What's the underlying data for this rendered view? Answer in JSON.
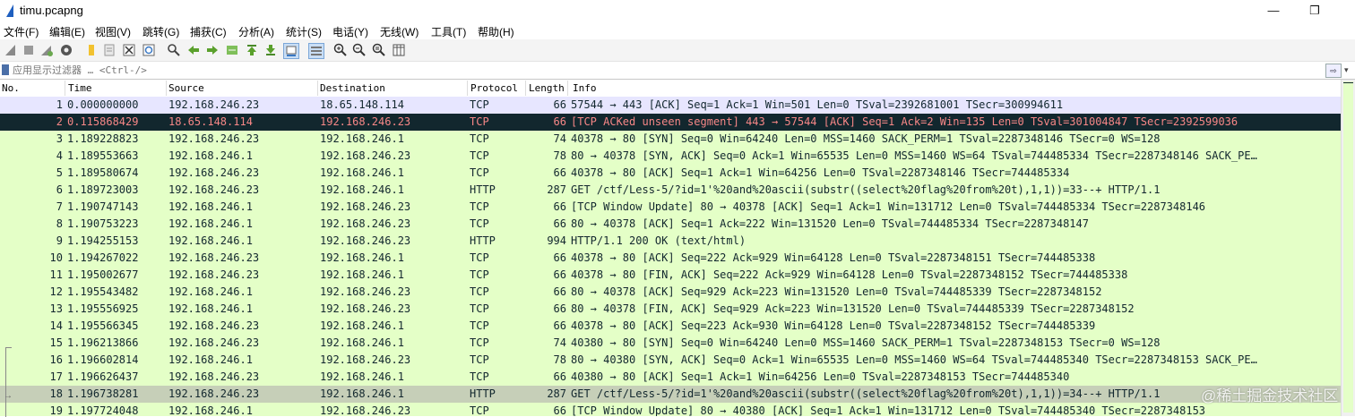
{
  "window": {
    "title": "timu.pcapng"
  },
  "menu": [
    "文件(F)",
    "编辑(E)",
    "视图(V)",
    "跳转(G)",
    "捕获(C)",
    "分析(A)",
    "统计(S)",
    "电话(Y)",
    "无线(W)",
    "工具(T)",
    "帮助(H)"
  ],
  "toolbar": {
    "icons": [
      "start-capture-icon",
      "stop-capture-icon",
      "restart-capture-icon",
      "capture-options-icon",
      "open-file-icon",
      "save-file-icon",
      "close-file-icon",
      "reload-file-icon",
      "find-packet-icon",
      "go-back-icon",
      "go-forward-icon",
      "go-to-packet-icon",
      "go-first-icon",
      "go-last-icon",
      "autoscroll-icon",
      "colorize-icon",
      "zoom-in-icon",
      "zoom-out-icon",
      "normal-size-icon",
      "resize-columns-icon"
    ]
  },
  "filter": {
    "placeholder": "应用显示过滤器 … <Ctrl-/>",
    "value": ""
  },
  "columns": [
    "No.",
    "Time",
    "Source",
    "Destination",
    "Protocol",
    "Length",
    "Info"
  ],
  "packets": [
    {
      "no": "1",
      "time": "0.000000000",
      "src": "192.168.246.23",
      "dst": "18.65.148.114",
      "proto": "TCP",
      "len": "66",
      "info": "57544 → 443 [ACK] Seq=1 Ack=1 Win=501 Len=0 TSval=2392681001 TSecr=300994611",
      "kind": "tcp"
    },
    {
      "no": "2",
      "time": "0.115868429",
      "src": "18.65.148.114",
      "dst": "192.168.246.23",
      "proto": "TCP",
      "len": "66",
      "info": "[TCP ACKed unseen segment] 443 → 57544 [ACK] Seq=1 Ack=2 Win=135 Len=0 TSval=301004847 TSecr=2392599036",
      "kind": "bad"
    },
    {
      "no": "3",
      "time": "1.189228823",
      "src": "192.168.246.23",
      "dst": "192.168.246.1",
      "proto": "TCP",
      "len": "74",
      "info": "40378 → 80 [SYN] Seq=0 Win=64240 Len=0 MSS=1460 SACK_PERM=1 TSval=2287348146 TSecr=0 WS=128",
      "kind": "green"
    },
    {
      "no": "4",
      "time": "1.189553663",
      "src": "192.168.246.1",
      "dst": "192.168.246.23",
      "proto": "TCP",
      "len": "78",
      "info": "80 → 40378 [SYN, ACK] Seq=0 Ack=1 Win=65535 Len=0 MSS=1460 WS=64 TSval=744485334 TSecr=2287348146 SACK_PE…",
      "kind": "green"
    },
    {
      "no": "5",
      "time": "1.189580674",
      "src": "192.168.246.23",
      "dst": "192.168.246.1",
      "proto": "TCP",
      "len": "66",
      "info": "40378 → 80 [ACK] Seq=1 Ack=1 Win=64256 Len=0 TSval=2287348146 TSecr=744485334",
      "kind": "green"
    },
    {
      "no": "6",
      "time": "1.189723003",
      "src": "192.168.246.23",
      "dst": "192.168.246.1",
      "proto": "HTTP",
      "len": "287",
      "info": "GET /ctf/Less-5/?id=1'%20and%20ascii(substr((select%20flag%20from%20t),1,1))=33--+ HTTP/1.1",
      "kind": "green"
    },
    {
      "no": "7",
      "time": "1.190747143",
      "src": "192.168.246.1",
      "dst": "192.168.246.23",
      "proto": "TCP",
      "len": "66",
      "info": "[TCP Window Update] 80 → 40378 [ACK] Seq=1 Ack=1 Win=131712 Len=0 TSval=744485334 TSecr=2287348146",
      "kind": "green"
    },
    {
      "no": "8",
      "time": "1.190753223",
      "src": "192.168.246.1",
      "dst": "192.168.246.23",
      "proto": "TCP",
      "len": "66",
      "info": "80 → 40378 [ACK] Seq=1 Ack=222 Win=131520 Len=0 TSval=744485334 TSecr=2287348147",
      "kind": "green"
    },
    {
      "no": "9",
      "time": "1.194255153",
      "src": "192.168.246.1",
      "dst": "192.168.246.23",
      "proto": "HTTP",
      "len": "994",
      "info": "HTTP/1.1 200 OK  (text/html)",
      "kind": "green"
    },
    {
      "no": "10",
      "time": "1.194267022",
      "src": "192.168.246.23",
      "dst": "192.168.246.1",
      "proto": "TCP",
      "len": "66",
      "info": "40378 → 80 [ACK] Seq=222 Ack=929 Win=64128 Len=0 TSval=2287348151 TSecr=744485338",
      "kind": "green"
    },
    {
      "no": "11",
      "time": "1.195002677",
      "src": "192.168.246.23",
      "dst": "192.168.246.1",
      "proto": "TCP",
      "len": "66",
      "info": "40378 → 80 [FIN, ACK] Seq=222 Ack=929 Win=64128 Len=0 TSval=2287348152 TSecr=744485338",
      "kind": "green"
    },
    {
      "no": "12",
      "time": "1.195543482",
      "src": "192.168.246.1",
      "dst": "192.168.246.23",
      "proto": "TCP",
      "len": "66",
      "info": "80 → 40378 [ACK] Seq=929 Ack=223 Win=131520 Len=0 TSval=744485339 TSecr=2287348152",
      "kind": "green"
    },
    {
      "no": "13",
      "time": "1.195556925",
      "src": "192.168.246.1",
      "dst": "192.168.246.23",
      "proto": "TCP",
      "len": "66",
      "info": "80 → 40378 [FIN, ACK] Seq=929 Ack=223 Win=131520 Len=0 TSval=744485339 TSecr=2287348152",
      "kind": "green"
    },
    {
      "no": "14",
      "time": "1.195566345",
      "src": "192.168.246.23",
      "dst": "192.168.246.1",
      "proto": "TCP",
      "len": "66",
      "info": "40378 → 80 [ACK] Seq=223 Ack=930 Win=64128 Len=0 TSval=2287348152 TSecr=744485339",
      "kind": "green"
    },
    {
      "no": "15",
      "time": "1.196213866",
      "src": "192.168.246.23",
      "dst": "192.168.246.1",
      "proto": "TCP",
      "len": "74",
      "info": "40380 → 80 [SYN] Seq=0 Win=64240 Len=0 MSS=1460 SACK_PERM=1 TSval=2287348153 TSecr=0 WS=128",
      "kind": "green"
    },
    {
      "no": "16",
      "time": "1.196602814",
      "src": "192.168.246.1",
      "dst": "192.168.246.23",
      "proto": "TCP",
      "len": "78",
      "info": "80 → 40380 [SYN, ACK] Seq=0 Ack=1 Win=65535 Len=0 MSS=1460 WS=64 TSval=744485340 TSecr=2287348153 SACK_PE…",
      "kind": "green"
    },
    {
      "no": "17",
      "time": "1.196626437",
      "src": "192.168.246.23",
      "dst": "192.168.246.1",
      "proto": "TCP",
      "len": "66",
      "info": "40380 → 80 [ACK] Seq=1 Ack=1 Win=64256 Len=0 TSval=2287348153 TSecr=744485340",
      "kind": "green"
    },
    {
      "no": "18",
      "time": "1.196738281",
      "src": "192.168.246.23",
      "dst": "192.168.246.1",
      "proto": "HTTP",
      "len": "287",
      "info": "GET /ctf/Less-5/?id=1'%20and%20ascii(substr((select%20flag%20from%20t),1,1))=34--+ HTTP/1.1",
      "kind": "sel"
    },
    {
      "no": "19",
      "time": "1.197724048",
      "src": "192.168.246.1",
      "dst": "192.168.246.23",
      "proto": "TCP",
      "len": "66",
      "info": "[TCP Window Update] 80 → 40380 [ACK] Seq=1 Ack=1 Win=131712 Len=0 TSval=744485340 TSecr=2287348153",
      "kind": "green"
    }
  ],
  "colors": {
    "tcp_row": "#e7e6ff",
    "green_row": "#e4ffc7",
    "bad_row_bg": "#12272e",
    "bad_row_fg": "#f78787",
    "selected_row": "#c6cfb8"
  },
  "watermark": "@稀土掘金技术社区"
}
